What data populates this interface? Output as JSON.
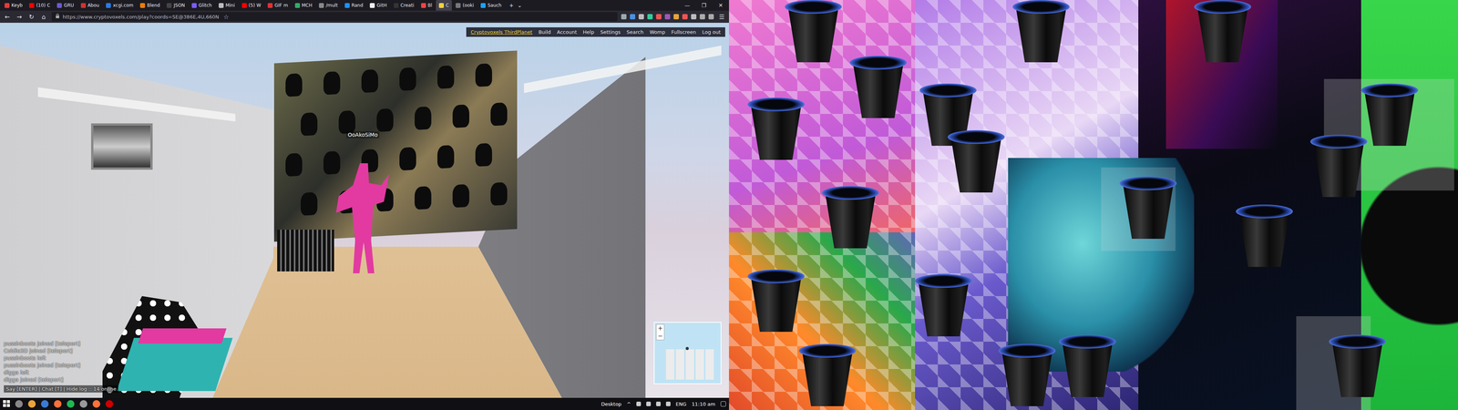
{
  "browser": {
    "tabs": [
      {
        "label": "Keyb",
        "selected": false
      },
      {
        "label": "(10) C",
        "selected": false
      },
      {
        "label": "GRU",
        "selected": false
      },
      {
        "label": "Abou",
        "selected": false
      },
      {
        "label": "xcgi.com",
        "selected": false
      },
      {
        "label": "Blend",
        "selected": false
      },
      {
        "label": "JSON",
        "selected": false
      },
      {
        "label": "Glitch",
        "selected": false
      },
      {
        "label": "Mini",
        "selected": false
      },
      {
        "label": "(5) W",
        "selected": false
      },
      {
        "label": "GIF m",
        "selected": false
      },
      {
        "label": "MCH",
        "selected": false
      },
      {
        "label": "/mult",
        "selected": false
      },
      {
        "label": "Rand",
        "selected": false
      },
      {
        "label": "GitH",
        "selected": false
      },
      {
        "label": "Creati",
        "selected": false
      },
      {
        "label": "Bl",
        "selected": false
      },
      {
        "label": "C",
        "selected": true
      },
      {
        "label": "(ooki",
        "selected": false
      },
      {
        "label": "Sauch",
        "selected": false
      }
    ],
    "new_tab": "+",
    "tab_list": "⌄",
    "window_controls": [
      "—",
      "❐",
      "✕"
    ],
    "nav": {
      "back": "←",
      "forward": "→",
      "reload": "↻",
      "home": "⌂"
    },
    "url": "https://www.cryptovoxels.com/play?coords=SE@386E,4U,660N",
    "bookmark": "☆",
    "menu": "☰"
  },
  "game": {
    "menu": {
      "world": "Cryptovoxels ThirdPlanet",
      "items": [
        "Build",
        "Account",
        "Help",
        "Settings",
        "Search",
        "Womp",
        "Fullscreen",
        "Log out"
      ]
    },
    "player_name": "OoAkoSiMo",
    "chat": {
      "lines": [
        "pussinboots joined [teleport]",
        "Coldie3D joined [teleport]",
        "pussinboots left",
        "pussinboots joined [teleport]",
        "digga left",
        "digga joined [teleport]"
      ],
      "footer": "Say [ENTER] | Chat [T] | Hide log :: 14 online"
    },
    "minimap": {
      "zoom_in": "+",
      "zoom_out": "−"
    }
  },
  "taskbar": {
    "desktop": "Desktop",
    "tray_arrow": "^",
    "language": "ENG",
    "time": "11:10 am"
  }
}
